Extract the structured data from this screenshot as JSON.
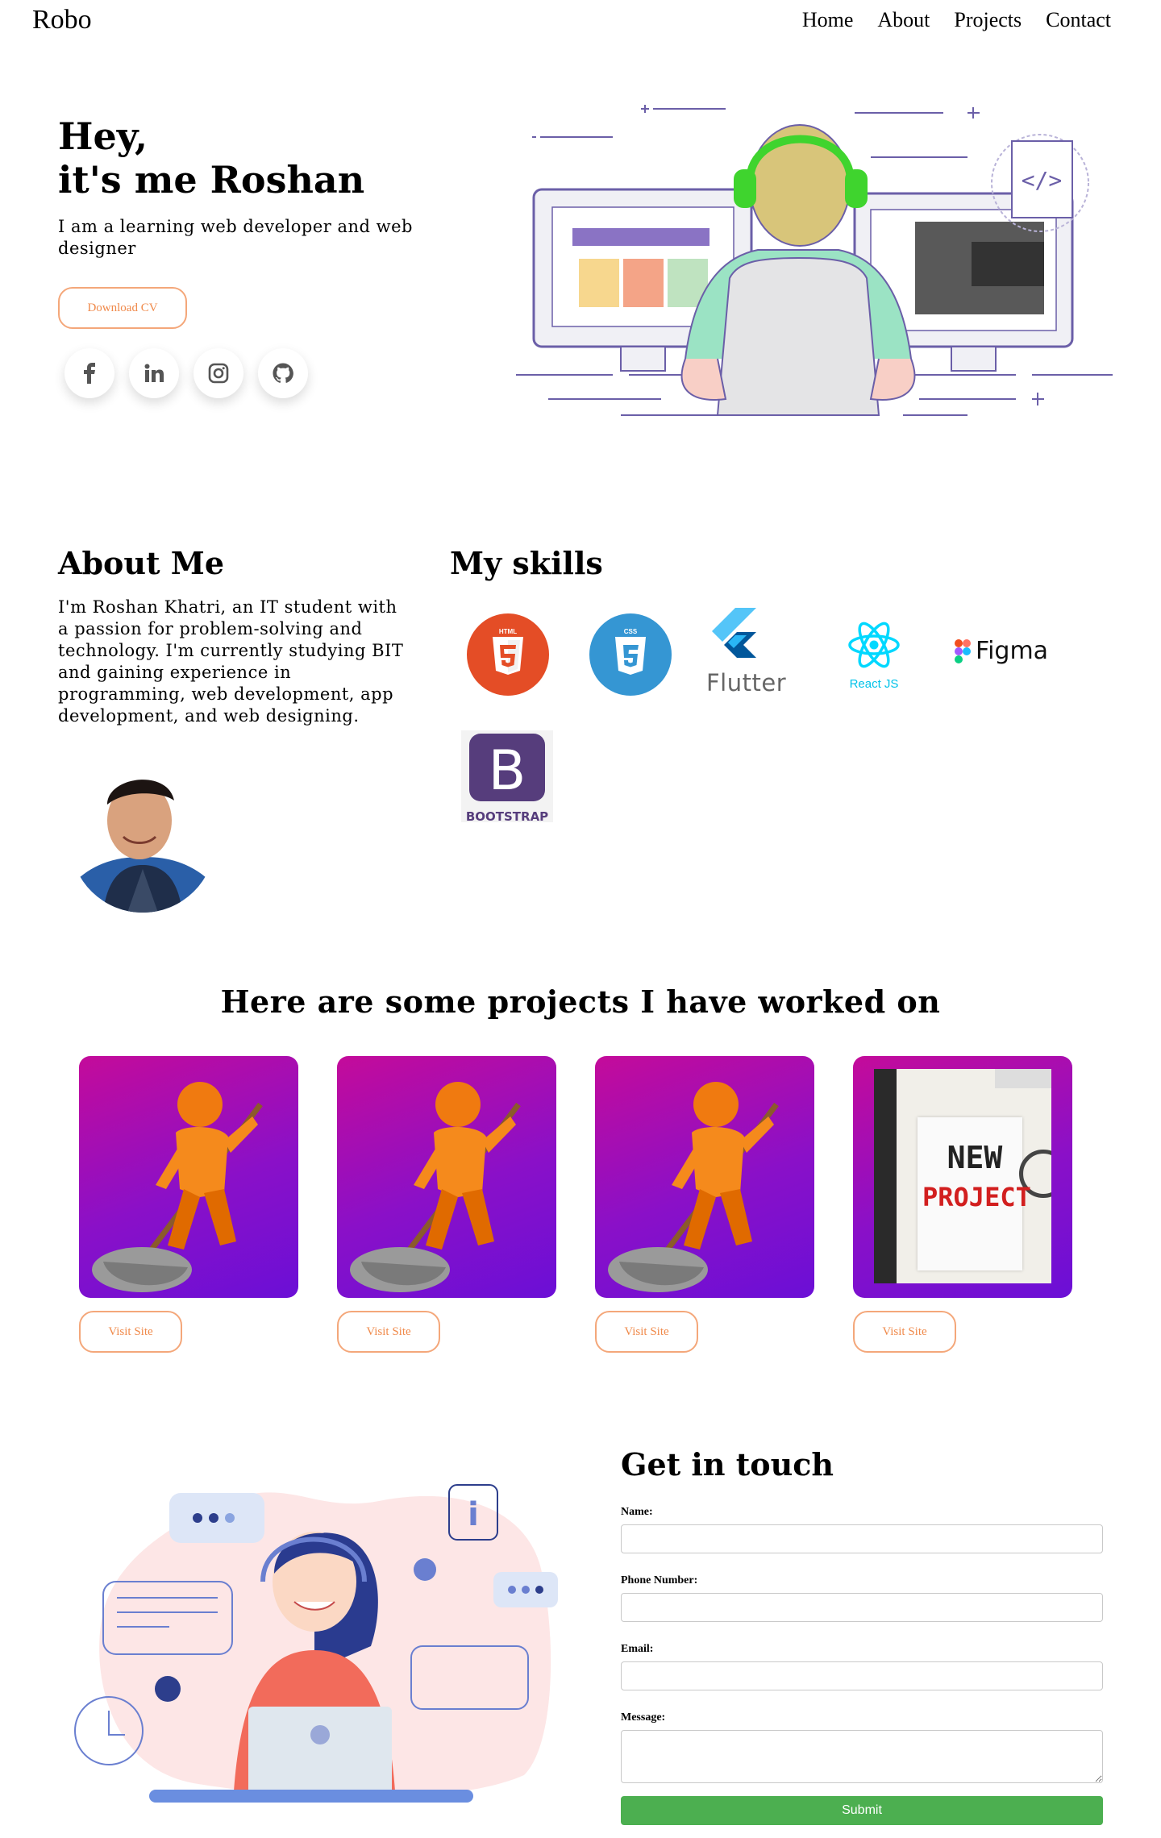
{
  "nav": {
    "brand": "Robo",
    "links": [
      "Home",
      "About",
      "Projects",
      "Contact"
    ]
  },
  "hero": {
    "line1": "Hey,",
    "line2": "it's me Roshan",
    "subtitle": "I am a learning web developer and web designer",
    "download_label": "Download CV",
    "socials": [
      "facebook-icon",
      "linkedin-icon",
      "instagram-icon",
      "github-icon"
    ]
  },
  "about": {
    "title": "About Me",
    "text": "I'm Roshan Khatri, an IT student with a passion for problem-solving and technology. I'm currently studying BIT and gaining experience in programming, web development, app development, and web designing."
  },
  "skills": {
    "title": "My skills",
    "items": [
      {
        "icon": "html5-icon",
        "label": "HTML"
      },
      {
        "icon": "css3-icon",
        "label": "CSS"
      },
      {
        "icon": "flutter-icon",
        "label": "Flutter"
      },
      {
        "icon": "react-icon",
        "label": "React JS"
      },
      {
        "icon": "figma-icon",
        "label": "Figma"
      },
      {
        "icon": "bootstrap-icon",
        "label": "BOOTSTRAP"
      }
    ]
  },
  "projects": {
    "title": "Here are some projects I have worked on",
    "visit_label": "Visit Site",
    "cards": [
      {
        "image": "mop-figure-image"
      },
      {
        "image": "mop-figure-image"
      },
      {
        "image": "mop-figure-image"
      },
      {
        "image": "new-project-image",
        "text_line1": "NEW",
        "text_line2": "PROJECT"
      }
    ]
  },
  "contact": {
    "title": "Get in touch",
    "fields": [
      {
        "label": "Name:"
      },
      {
        "label": "Phone Number:"
      },
      {
        "label": "Email:"
      },
      {
        "label": "Message:"
      }
    ],
    "submit_label": "Submit"
  },
  "colors": {
    "accent_orange": "#f08a4b",
    "card_gradient_start": "#c40b9a",
    "card_gradient_end": "#6b0fd6",
    "submit_green": "#4caf50"
  }
}
